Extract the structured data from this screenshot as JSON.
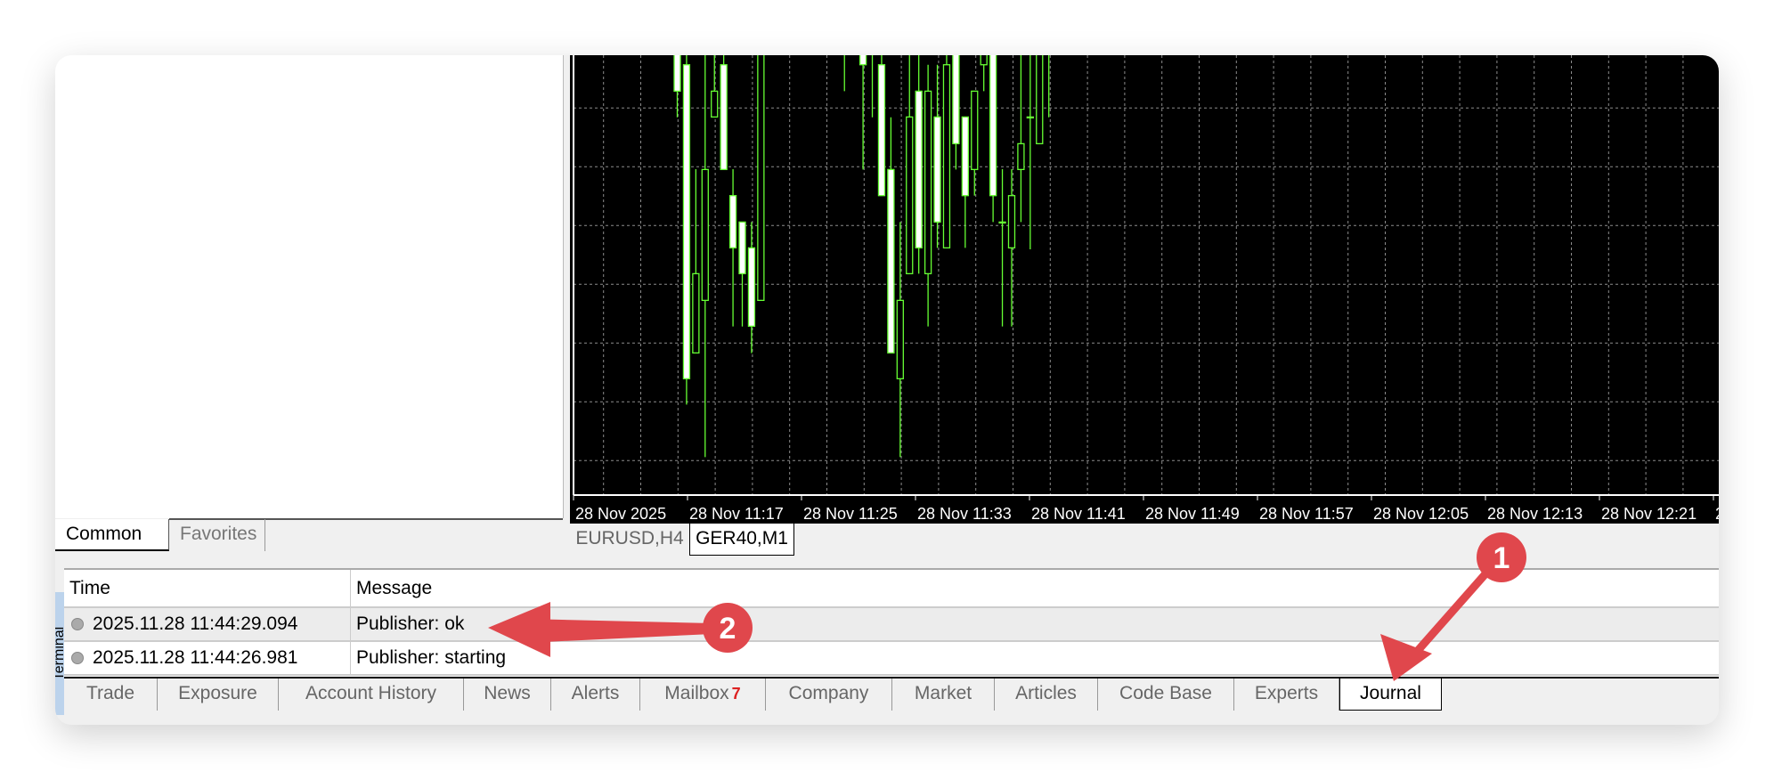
{
  "navigator": {
    "tabs": [
      "Common",
      "Favorites"
    ],
    "active": "Common"
  },
  "chart": {
    "tabs": [
      "EURUSD,H4",
      "GER40,M1"
    ],
    "active_tab": "GER40,M1",
    "time_labels": [
      "28 Nov 2025",
      "28 Nov 11:17",
      "28 Nov 11:25",
      "28 Nov 11:33",
      "28 Nov 11:41",
      "28 Nov 11:49",
      "28 Nov 11:57",
      "28 Nov 12:05",
      "28 Nov 12:13",
      "28 Nov 12:21",
      "2"
    ],
    "colors": {
      "background": "#000000",
      "candle_outline": "#66ff33",
      "grid": "#8c8c8c"
    }
  },
  "chart_data": {
    "type": "candlestick",
    "price_range": [
      0,
      146.5
    ],
    "candles": [
      {
        "i": 0,
        "o": 160,
        "h": 165,
        "l": 125.5,
        "c": 134.3
      },
      {
        "i": 1,
        "o": 143.2,
        "h": 150,
        "l": 28.7,
        "c": 37.4
      },
      {
        "i": 2,
        "o": 46.1,
        "h": 108,
        "l": 46.1,
        "c": 72.8
      },
      {
        "i": 3,
        "o": 63.8,
        "h": 160,
        "l": 11,
        "c": 107.9
      },
      {
        "i": 4,
        "o": 125.6,
        "h": 160,
        "l": 125.6,
        "c": 134.3
      },
      {
        "i": 5,
        "o": 143.2,
        "h": 160,
        "l": 107.9,
        "c": 107.9
      },
      {
        "i": 6,
        "o": 99.1,
        "h": 108,
        "l": 55,
        "c": 81.5
      },
      {
        "i": 7,
        "o": 90.2,
        "h": 90.2,
        "l": 55,
        "c": 72.8
      },
      {
        "i": 8,
        "o": 81.5,
        "h": 90.2,
        "l": 46,
        "c": 55.1
      },
      {
        "i": 9,
        "o": 63.8,
        "h": 165,
        "l": 63.8,
        "c": 160
      },
      {
        "i": 18,
        "o": 158,
        "h": 165,
        "l": 134.3,
        "c": 155
      },
      {
        "i": 20,
        "o": 160,
        "h": 165,
        "l": 107.9,
        "c": 143.2
      },
      {
        "i": 21,
        "o": 158,
        "h": 165,
        "l": 125.5,
        "c": 162
      },
      {
        "i": 22,
        "o": 143.2,
        "h": 150,
        "l": 99.1,
        "c": 99.1
      },
      {
        "i": 23,
        "o": 107.9,
        "h": 125.5,
        "l": 46.1,
        "c": 46.1
      },
      {
        "i": 24,
        "o": 37.4,
        "h": 90.2,
        "l": 11,
        "c": 63.8
      },
      {
        "i": 25,
        "o": 72.8,
        "h": 160,
        "l": 72.8,
        "c": 125.6
      },
      {
        "i": 26,
        "o": 134.3,
        "h": 165,
        "l": 72.8,
        "c": 81.5
      },
      {
        "i": 27,
        "o": 72.8,
        "h": 143.2,
        "l": 55,
        "c": 134.3
      },
      {
        "i": 28,
        "o": 125.6,
        "h": 143.2,
        "l": 81.5,
        "c": 90.2
      },
      {
        "i": 29,
        "o": 81.5,
        "h": 160,
        "l": 81.5,
        "c": 143.2
      },
      {
        "i": 30,
        "o": 165,
        "h": 170,
        "l": 107.9,
        "c": 116.6
      },
      {
        "i": 31,
        "o": 125.6,
        "h": 125.6,
        "l": 81.5,
        "c": 99.1
      },
      {
        "i": 32,
        "o": 107.9,
        "h": 134.3,
        "l": 99.1,
        "c": 134.3
      },
      {
        "i": 33,
        "o": 143.2,
        "h": 160,
        "l": 134.3,
        "c": 150
      },
      {
        "i": 34,
        "o": 160,
        "h": 165,
        "l": 90.2,
        "c": 99.1
      },
      {
        "i": 35,
        "o": 90.2,
        "h": 108,
        "l": 55,
        "c": 90.2
      },
      {
        "i": 36,
        "o": 81.5,
        "h": 108,
        "l": 55,
        "c": 99.1
      },
      {
        "i": 37,
        "o": 107.9,
        "h": 160,
        "l": 90.2,
        "c": 116.6
      },
      {
        "i": 38,
        "o": 125.6,
        "h": 160,
        "l": 81,
        "c": 125.6
      },
      {
        "i": 39,
        "o": 116.6,
        "h": 160,
        "l": 116.6,
        "c": 155
      },
      {
        "i": 40,
        "o": 158,
        "h": 165,
        "l": 125.5,
        "c": 160
      }
    ]
  },
  "journal": {
    "columns": [
      "Time",
      "Message"
    ],
    "rows": [
      {
        "time": "2025.11.28 11:44:29.094",
        "message": "Publisher: ok"
      },
      {
        "time": "2025.11.28 11:44:26.981",
        "message": "Publisher: starting"
      }
    ]
  },
  "terminal": {
    "side_label": "Terminal",
    "tabs": [
      "Trade",
      "Exposure",
      "Account History",
      "News",
      "Alerts",
      "Mailbox",
      "Company",
      "Market",
      "Articles",
      "Code Base",
      "Experts",
      "Journal"
    ],
    "mailbox_badge": "7",
    "active_tab": "Journal"
  },
  "annotations": {
    "step1": "1",
    "step2": "2",
    "color": "#e0474c"
  }
}
